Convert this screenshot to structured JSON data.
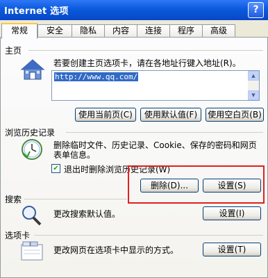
{
  "window": {
    "title": "Internet 选项",
    "help": "?"
  },
  "tabs": [
    "常规",
    "安全",
    "隐私",
    "内容",
    "连接",
    "程序",
    "高级"
  ],
  "home": {
    "title": "主页",
    "desc": "若要创建主页选项卡，请在各地址行键入地址(R)。",
    "url": "http://www.qq.com/",
    "buttons": [
      "使用当前页(C)",
      "使用默认值(F)",
      "使用空白页(B)"
    ]
  },
  "history": {
    "title": "浏览历史记录",
    "desc_line1": "删除临时文件、历史记录、Cookie、保存的密码和网页",
    "desc_line2": "表单信息。",
    "checkbox_label": "退出时删除浏览历史记录(W)",
    "checked": true,
    "delete_label": "删除(D)...",
    "settings_label": "设置(S)"
  },
  "search": {
    "title": "搜索",
    "desc": "更改搜索默认值。",
    "settings_label": "设置(I)"
  },
  "tabsec": {
    "title": "选项卡",
    "desc": "更改网页在选项卡中显示的方式。",
    "settings_label": "设置(T)"
  },
  "colors": {
    "highlight": "#e0201c",
    "titlebar": "#0a5bdc"
  }
}
